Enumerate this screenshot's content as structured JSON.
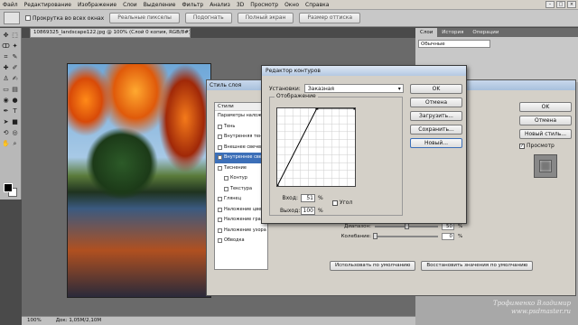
{
  "menu": {
    "items": [
      "Файл",
      "Редактирование",
      "Изображение",
      "Слои",
      "Выделение",
      "Фильтр",
      "Анализ",
      "3D",
      "Просмотр",
      "Окно",
      "Справка"
    ]
  },
  "options_bar": {
    "all_layers_label": "Прокрутка во всех окнах",
    "buttons": [
      "Реальные пикселы",
      "Подогнать",
      "Полный экран",
      "Размер оттиска"
    ]
  },
  "document": {
    "tab_title": "10869325_landscape122.jpg @ 100% (Слой 0 копия, RGB/8#)",
    "status_zoom": "100%",
    "status_doc": "Док: 1,05M/2,10M"
  },
  "right_panels": {
    "tabs": [
      "Слои",
      "История",
      "Операции"
    ],
    "blend_mode": "Обычные"
  },
  "layer_style": {
    "title": "Стиль слоя",
    "styles_header": "Стили",
    "items": [
      {
        "label": "Параметры наложения",
        "checkbox": false,
        "sub": false,
        "selected": false
      },
      {
        "label": "Тень",
        "checkbox": true,
        "sub": false,
        "selected": false
      },
      {
        "label": "Внутренняя тень",
        "checkbox": true,
        "sub": false,
        "selected": false
      },
      {
        "label": "Внешнее свечение",
        "checkbox": true,
        "sub": false,
        "selected": false
      },
      {
        "label": "Внутреннее свечение",
        "checkbox": true,
        "sub": false,
        "selected": true
      },
      {
        "label": "Тиснение",
        "checkbox": true,
        "sub": false,
        "selected": false
      },
      {
        "label": "Контур",
        "checkbox": true,
        "sub": true,
        "selected": false
      },
      {
        "label": "Текстура",
        "checkbox": true,
        "sub": true,
        "selected": false
      },
      {
        "label": "Глянец",
        "checkbox": true,
        "sub": false,
        "selected": false
      },
      {
        "label": "Наложение цвета",
        "checkbox": true,
        "sub": false,
        "selected": false
      },
      {
        "label": "Наложение градиента",
        "checkbox": true,
        "sub": false,
        "selected": false
      },
      {
        "label": "Наложение узора",
        "checkbox": true,
        "sub": false,
        "selected": false
      },
      {
        "label": "Обводка",
        "checkbox": true,
        "sub": false,
        "selected": false
      }
    ],
    "ok_label": "OK",
    "cancel_label": "Отмена",
    "new_style_label": "Новый стиль...",
    "preview_label": "Просмотр",
    "range_label": "Диапазон:",
    "range_value": "50",
    "range_fraction": 0.5,
    "jitter_label": "Колебание:",
    "jitter_value": "0",
    "jitter_fraction": 0.0,
    "percent": "%",
    "default_btn": "Использовать по умолчанию",
    "reset_btn": "Восстановить значения по умолчанию"
  },
  "curves": {
    "title": "Редактор контуров",
    "preset_label": "Установки:",
    "preset_value": "Заказная",
    "mapping_label": "Отображение",
    "input_label": "Вход:",
    "input_value": "51",
    "output_label": "Выход:",
    "output_value": "100",
    "percent": "%",
    "corner_label": "Угол",
    "ok_label": "OK",
    "cancel_label": "Отмена",
    "load_label": "Загрузить...",
    "save_label": "Сохранить...",
    "new_label": "Новый...",
    "curve_points": [
      [
        0,
        0
      ],
      [
        51,
        100
      ],
      [
        100,
        100
      ]
    ]
  },
  "watermark": {
    "line1": "Трофименко Владимир",
    "line2": "www.psdmaster.ru"
  }
}
